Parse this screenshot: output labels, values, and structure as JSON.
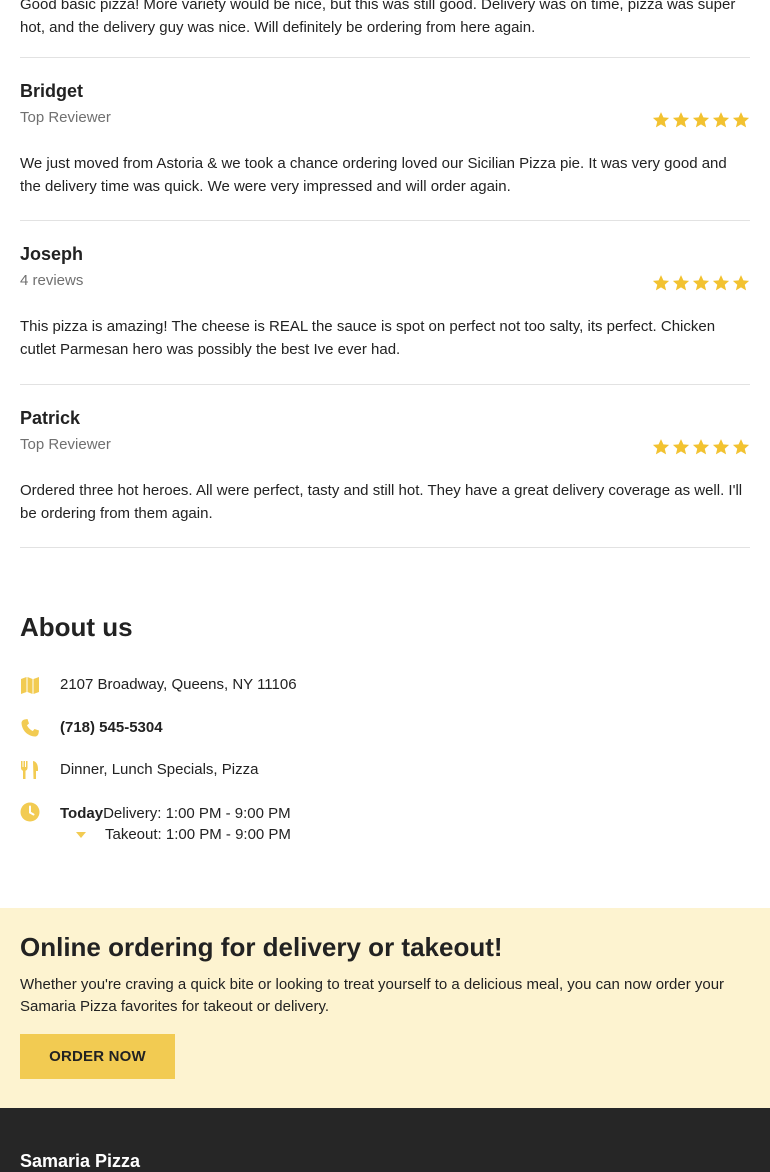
{
  "reviews": {
    "top_text": "Good basic pizza! More variety would be nice, but this was still good. Delivery was on time, pizza was super hot, and the delivery guy was nice. Will definitely be ordering from here again.",
    "items": [
      {
        "name": "Bridget",
        "subtitle": "Top Reviewer",
        "rating": 5,
        "text": "We just moved from Astoria & we took a chance ordering loved our Sicilian Pizza pie. It was very good and the delivery time was quick. We were very impressed and will order again."
      },
      {
        "name": "Joseph",
        "subtitle": "4 reviews",
        "rating": 5,
        "text": "This pizza is amazing! The cheese is REAL the sauce is spot on perfect not too salty, its perfect. Chicken cutlet Parmesan hero was possibly the best Ive ever had."
      },
      {
        "name": "Patrick",
        "subtitle": "Top Reviewer",
        "rating": 5,
        "text": "Ordered three hot heroes. All were perfect, tasty and still hot. They have a great delivery coverage as well. I'll be ordering from them again."
      }
    ]
  },
  "about": {
    "title": "About us",
    "address": "2107 Broadway, Queens, NY 11106",
    "phone": "(718) 545-5304",
    "cuisine": "Dinner, Lunch Specials, Pizza",
    "hours": {
      "today_label": "Today",
      "delivery": "Delivery: 1:00 PM - 9:00 PM",
      "takeout": "Takeout: 1:00 PM - 9:00 PM"
    }
  },
  "promo": {
    "title": "Online ordering for delivery or takeout!",
    "text": "Whether you're craving a quick bite or looking to treat yourself to a delicious meal, you can now order your Samaria Pizza favorites for takeout or delivery.",
    "button_label": "ORDER NOW"
  },
  "footer": {
    "title": "Samaria Pizza"
  },
  "colors": {
    "accent": "#f2cb52",
    "promo_bg": "#fdf3d0",
    "footer_bg": "#262626"
  }
}
